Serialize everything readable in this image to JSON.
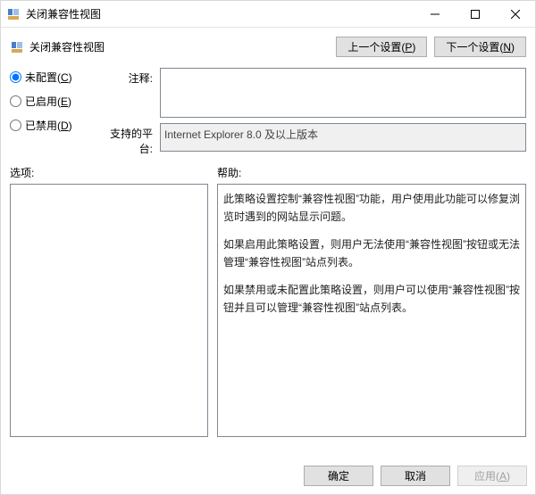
{
  "window": {
    "title": "关闭兼容性视图",
    "sub_title": "关闭兼容性视图"
  },
  "nav": {
    "prev_label_pre": "上一个设置(",
    "prev_accel": "P",
    "prev_label_post": ")",
    "next_label_pre": "下一个设置(",
    "next_accel": "N",
    "next_label_post": ")"
  },
  "radios": {
    "not_configured": {
      "label_pre": "未配置(",
      "accel": "C",
      "label_post": ")",
      "checked": true
    },
    "enabled": {
      "label_pre": "已启用(",
      "accel": "E",
      "label_post": ")",
      "checked": false
    },
    "disabled": {
      "label_pre": "已禁用(",
      "accel": "D",
      "label_post": ")",
      "checked": false
    }
  },
  "fields": {
    "comment_label": "注释:",
    "comment_value": "",
    "platform_label": "支持的平台:",
    "platform_value": "Internet Explorer 8.0 及以上版本"
  },
  "panes": {
    "options_label": "选项:",
    "help_label": "帮助:",
    "help_paragraphs": [
      "此策略设置控制“兼容性视图”功能，用户使用此功能可以修复浏览时遇到的网站显示问题。",
      "如果启用此策略设置，则用户无法使用“兼容性视图”按钮或无法管理“兼容性视图”站点列表。",
      "如果禁用或未配置此策略设置，则用户可以使用“兼容性视图”按钮并且可以管理“兼容性视图”站点列表。"
    ]
  },
  "buttons": {
    "ok": "确定",
    "cancel": "取消",
    "apply_pre": "应用(",
    "apply_accel": "A",
    "apply_post": ")"
  }
}
